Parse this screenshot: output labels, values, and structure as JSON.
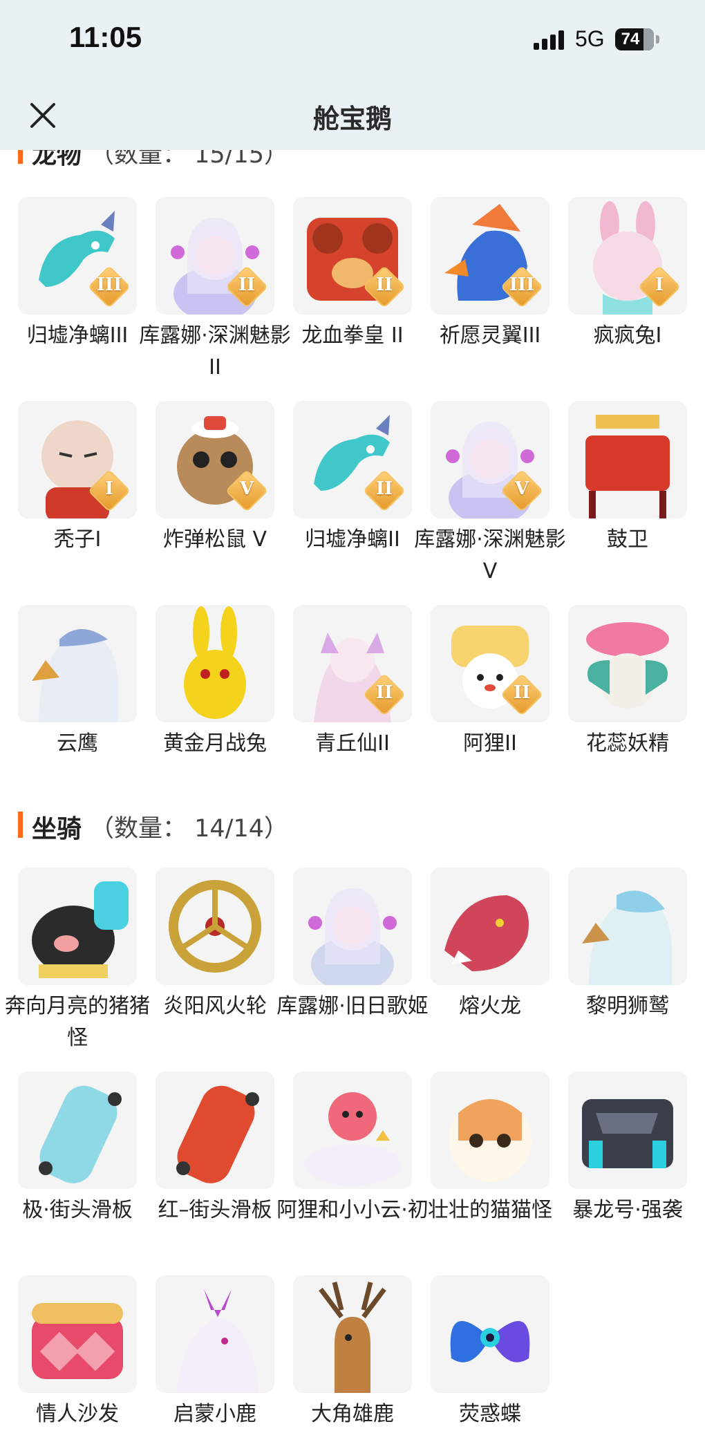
{
  "status_bar": {
    "time": "11:05",
    "network": "5G",
    "battery": "74"
  },
  "nav": {
    "title": "舱宝鹅",
    "close_icon": "close-icon"
  },
  "pets": {
    "title": "龙物",
    "count_label": "（数量： 15/15）",
    "items": [
      {
        "name": "归墟净螭III",
        "badge": "III",
        "color": "#3fc7c9",
        "icon": "dragon"
      },
      {
        "name": "库露娜·深渊魅影II",
        "badge": "II",
        "color": "#c9c3f2",
        "icon": "doll"
      },
      {
        "name": "龙血拳皇 II",
        "badge": "II",
        "color": "#d5432d",
        "icon": "beast"
      },
      {
        "name": "祈愿灵翼III",
        "badge": "III",
        "color": "#3a6fd8",
        "icon": "bird"
      },
      {
        "name": "疯疯兔I",
        "badge": "I",
        "color": "#f2b8d2",
        "icon": "rabbit"
      },
      {
        "name": "秃子I",
        "badge": "I",
        "color": "#eed7c8",
        "icon": "head"
      },
      {
        "name": "炸弹松鼠 V",
        "badge": "V",
        "color": "#b98a5a",
        "icon": "squirrel"
      },
      {
        "name": "归墟净螭II",
        "badge": "II",
        "color": "#3fc7c9",
        "icon": "dragon"
      },
      {
        "name": "库露娜·深渊魅影V",
        "badge": "V",
        "color": "#c9c3f2",
        "icon": "doll"
      },
      {
        "name": "鼓卫",
        "badge": "",
        "color": "#d83a2a",
        "icon": "drum"
      },
      {
        "name": "云鹰",
        "badge": "",
        "color": "#8fa6d8",
        "icon": "eagle"
      },
      {
        "name": "黄金月战兔",
        "badge": "",
        "color": "#f5d21c",
        "icon": "goldrabbit"
      },
      {
        "name": "青丘仙II",
        "badge": "II",
        "color": "#d9a9e6",
        "icon": "fox"
      },
      {
        "name": "阿狸II",
        "badge": "II",
        "color": "#f6d36d",
        "icon": "ali"
      },
      {
        "name": "花蕊妖精",
        "badge": "",
        "color": "#f07aa2",
        "icon": "flower"
      }
    ]
  },
  "mounts": {
    "title": "坐骑",
    "count_label": "（数量：  14/14）",
    "items": [
      {
        "name": "奔向月亮的猪猪怪",
        "color": "#2b2b2b",
        "icon": "pig"
      },
      {
        "name": "炎阳风火轮",
        "color": "#c9a23a",
        "icon": "wheel"
      },
      {
        "name": "库露娜·旧日歌姬",
        "color": "#cfd8ef",
        "icon": "doll"
      },
      {
        "name": "熔火龙",
        "color": "#d0455a",
        "icon": "lavadragon"
      },
      {
        "name": "黎明狮鹫",
        "color": "#8fd0e8",
        "icon": "griffin"
      },
      {
        "name": "极·街头滑板",
        "color": "#8fd8e6",
        "icon": "skateboard"
      },
      {
        "name": "红–街头滑板",
        "color": "#e04a2e",
        "icon": "skateboard"
      },
      {
        "name": "阿狸和小小云·初",
        "color": "#f0697a",
        "icon": "alicloud"
      },
      {
        "name": "壮壮的猫猫怪",
        "color": "#f0a35c",
        "icon": "cat"
      },
      {
        "name": "暴龙号·强袭",
        "color": "#3a3f4a",
        "icon": "mecha"
      },
      {
        "name": "情人沙发",
        "color": "#e84a6a",
        "icon": "sofa"
      },
      {
        "name": "启蒙小鹿",
        "color": "#b84ad0",
        "icon": "whitedeer"
      },
      {
        "name": "大角雄鹿",
        "color": "#c08042",
        "icon": "stag"
      },
      {
        "name": "荧惑蝶",
        "color": "#2f6fe0",
        "icon": "butterfly"
      }
    ]
  }
}
